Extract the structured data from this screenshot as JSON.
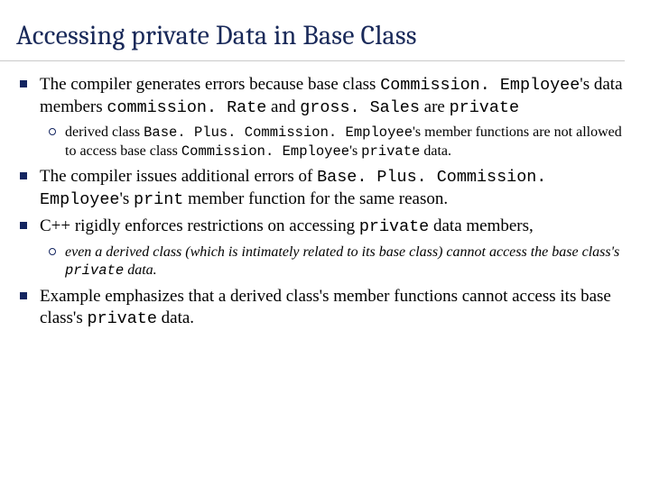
{
  "title": "Accessing private Data in Base Class",
  "b1": {
    "p1": "The compiler generates errors because base class ",
    "c1": "Commission. Employee",
    "p2": "'s data members ",
    "c2": "commission. Rate",
    "p3": " and ",
    "c3": "gross. Sales",
    "p4": " are ",
    "c4": "private",
    "sub": {
      "p1": "derived class ",
      "c1": "Base. Plus. Commission. Employee",
      "p2": "'s member functions are not allowed to access base class ",
      "c2": "Commission. Employee",
      "p3": "'s ",
      "c3": "private",
      "p4": " data."
    }
  },
  "b2": {
    "p1": "The compiler issues additional errors of ",
    "c1": "Base. Plus. Commission. Employee",
    "p2": "'s ",
    "c2": "print",
    "p3": " member function for the same reason."
  },
  "b3": {
    "p1": "C++ rigidly enforces restrictions on accessing ",
    "c1": "private",
    "p2": " data members,",
    "sub": {
      "p1": "even a derived class (which is intimately related to its base class) cannot access the base class's ",
      "c1": "private",
      "p2": " data."
    }
  },
  "b4": {
    "p1": "Example emphasizes that a derived class's member functions cannot access its base class's ",
    "c1": "private",
    "p2": " data."
  }
}
